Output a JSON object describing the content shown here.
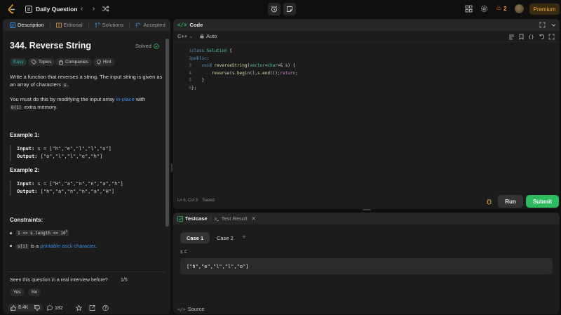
{
  "nav": {
    "title": "Daily Question",
    "streak": "2",
    "premium": "Premium"
  },
  "left_tabs": [
    {
      "label": "Description",
      "icon": "description-icon"
    },
    {
      "label": "Editorial",
      "icon": "editorial-icon"
    },
    {
      "label": "Solutions",
      "icon": "solutions-icon"
    },
    {
      "label": "Accepted",
      "icon": "accepted-icon"
    }
  ],
  "problem": {
    "title": "344. Reverse String",
    "status": "Solved",
    "difficulty": "Easy",
    "tags": [
      "Topics",
      "Companies",
      "Hint"
    ],
    "desc1_a": "Write a function that reverses a string. The input string is given as an array of characters",
    "desc1_code": "s",
    "desc1_b": ".",
    "desc2_a": "You must do this by modifying the input array",
    "desc2_link": "in-place",
    "desc2_b": "with",
    "desc2_code": "O(1)",
    "desc2_c": "extra memory.",
    "example1_title": "Example 1:",
    "example1_input_label": "Input:",
    "example1_input": "s = [\"h\",\"e\",\"l\",\"l\",\"o\"]",
    "example1_output_label": "Output:",
    "example1_output": "[\"o\",\"l\",\"l\",\"e\",\"h\"]",
    "example2_title": "Example 2:",
    "example2_input_label": "Input:",
    "example2_input": "s = [\"H\",\"a\",\"n\",\"n\",\"a\",\"h\"]",
    "example2_output_label": "Output:",
    "example2_output": "[\"h\",\"a\",\"n\",\"n\",\"a\",\"H\"]",
    "constraints_title": "Constraints:",
    "constraint1_code": "1 <= s.length <= 10",
    "constraint1_sup": "5",
    "constraint2_code": "s[i]",
    "constraint2_text": "is a",
    "constraint2_link": "printable ascii character",
    "constraint2_end": ".",
    "seen_question": "Seen this question in a real interview before?",
    "seen_count": "1/5",
    "yes": "Yes",
    "no": "No",
    "likes": "8.4K",
    "comments": "182"
  },
  "code_panel": {
    "title": "Code",
    "language": "C++",
    "auto": "Auto",
    "line_numbers": [
      "1",
      "2",
      "3",
      "4",
      "5",
      "6"
    ],
    "lines": [
      "class Solution {",
      "public:",
      "    void reverseString(vector<char>& s) {",
      "        reverse(s.begin(),s.end());return;",
      "    }",
      "};"
    ],
    "status": "Ln 6, Col 3",
    "saved": "Saved",
    "run": "Run",
    "submit": "Submit"
  },
  "test_panel": {
    "tab_testcase": "Testcase",
    "tab_result": "Test Result",
    "case1": "Case 1",
    "case2": "Case 2",
    "var_label": "s =",
    "var_value": "[\"h\",\"e\",\"l\",\"l\",\"o\"]",
    "source": "Source"
  },
  "colors": {
    "accent_green": "#2cbb5d",
    "easy_teal": "#2cbcaf",
    "link_blue": "#3c8dde",
    "premium_orange": "#f1a93a"
  }
}
